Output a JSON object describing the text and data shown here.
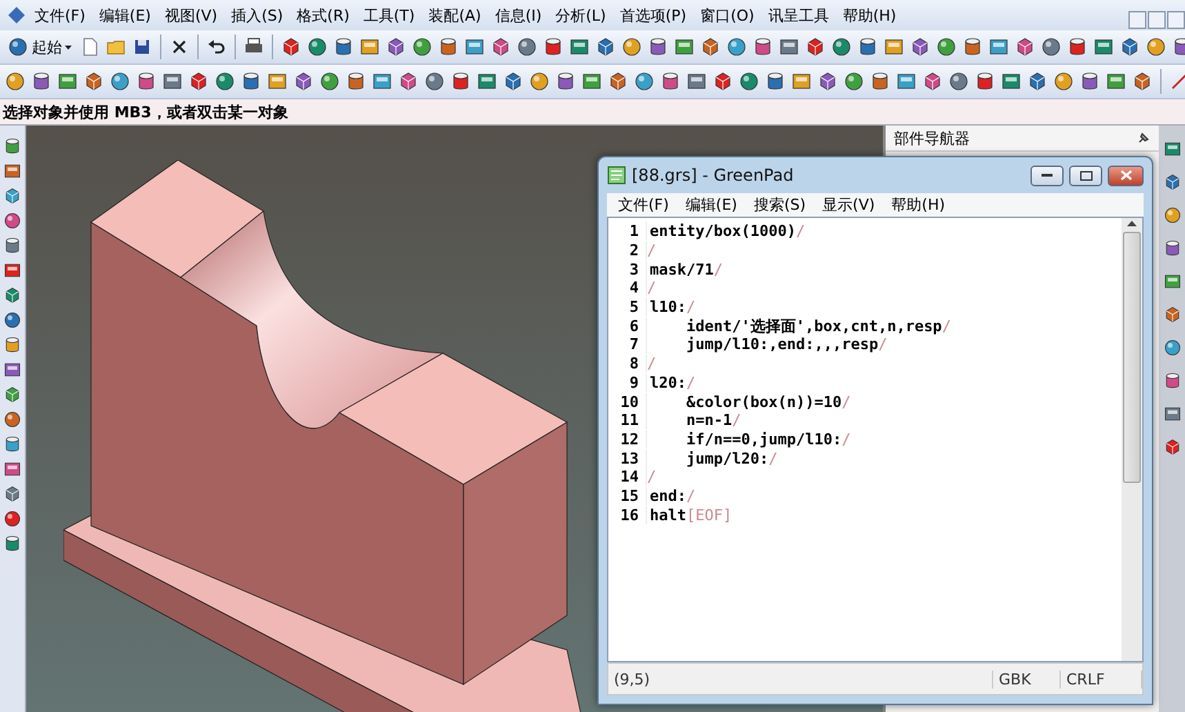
{
  "menu": [
    "文件(F)",
    "编辑(E)",
    "视图(V)",
    "插入(S)",
    "格式(R)",
    "工具(T)",
    "装配(A)",
    "信息(I)",
    "分析(L)",
    "首选项(P)",
    "窗口(O)",
    "讯呈工具",
    "帮助(H)"
  ],
  "start_button": {
    "label": "起始"
  },
  "prompt": "选择对象并使用 MB3，或者双击某一对象",
  "navigator": {
    "title": "部件导航器"
  },
  "editor": {
    "title": "[88.grs] - GreenPad",
    "menu": [
      "文件(F)",
      "编辑(E)",
      "搜索(S)",
      "显示(V)",
      "帮助(H)"
    ],
    "lines": [
      {
        "number": "1",
        "text": "entity/box(1000)",
        "end": "/"
      },
      {
        "number": "2",
        "end": "/"
      },
      {
        "number": "3",
        "text": "mask/71",
        "end": "/"
      },
      {
        "number": "4",
        "end": "/"
      },
      {
        "number": "5",
        "text": "l10:",
        "end": "/"
      },
      {
        "number": "6",
        "text": "    ident/'选择面',box,cnt,n,resp",
        "end": "/"
      },
      {
        "number": "7",
        "text": "    jump/l10:,end:,,,resp",
        "end": "/"
      },
      {
        "number": "8",
        "end": "/"
      },
      {
        "number": "9",
        "text": "l20:",
        "end": "/"
      },
      {
        "number": "10",
        "text": "    &color(box(n))=10",
        "end": "/"
      },
      {
        "number": "11",
        "text": "    n=n-1",
        "end": "/"
      },
      {
        "number": "12",
        "text": "    if/n==0,jump/l10:",
        "end": "/"
      },
      {
        "number": "13",
        "text": "    jump/l20:",
        "end": "/"
      },
      {
        "number": "14",
        "end": "/"
      },
      {
        "number": "15",
        "text": "end:",
        "end": "/"
      },
      {
        "number": "16",
        "text": "halt",
        "end": "[EOF]"
      }
    ],
    "status": {
      "position": "(9,5)",
      "encoding": "GBK",
      "line_ending": "CRLF"
    }
  }
}
